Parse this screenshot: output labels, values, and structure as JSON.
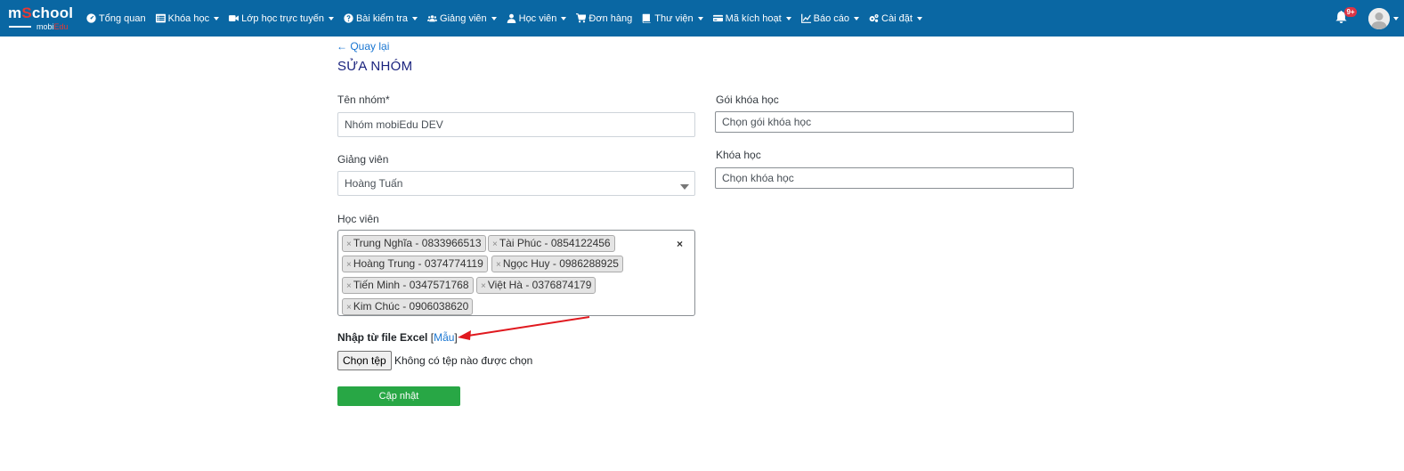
{
  "brand": {
    "logo_main_a": "m",
    "logo_main_b": "S",
    "logo_main_c": "chool",
    "logo_sub_a": "mobi",
    "logo_sub_b": "Edu"
  },
  "nav": {
    "items": [
      {
        "label": "Tổng quan",
        "icon": "dashboard-icon",
        "dropdown": false
      },
      {
        "label": "Khóa học",
        "icon": "list-icon",
        "dropdown": true
      },
      {
        "label": "Lớp học trực tuyến",
        "icon": "video-icon",
        "dropdown": true
      },
      {
        "label": "Bài kiểm tra",
        "icon": "question-circle-icon",
        "dropdown": true
      },
      {
        "label": "Giảng viên",
        "icon": "users-icon",
        "dropdown": true
      },
      {
        "label": "Học viên",
        "icon": "user-icon",
        "dropdown": true
      },
      {
        "label": "Đơn hàng",
        "icon": "cart-icon",
        "dropdown": false
      },
      {
        "label": "Thư viện",
        "icon": "book-icon",
        "dropdown": true
      },
      {
        "label": "Mã kích hoạt",
        "icon": "credit-card-icon",
        "dropdown": true
      },
      {
        "label": "Báo cáo",
        "icon": "chart-line-icon",
        "dropdown": true
      },
      {
        "label": "Cài đặt",
        "icon": "gears-icon",
        "dropdown": true
      }
    ],
    "notification_count": "9+"
  },
  "page": {
    "back_label": "← Quay lại",
    "title": "SỬA NHÓM"
  },
  "form": {
    "group_name_label": "Tên nhóm*",
    "group_name_value": "Nhóm mobiEdu DEV",
    "teacher_label": "Giảng viên",
    "teacher_value": "Hoàng Tuấn",
    "students_label": "Học viên",
    "students": [
      "Trung Nghĩa - 0833966513",
      "Tài Phúc - 0854122456",
      "Hoàng Trung - 0374774119",
      "Ngọc Huy - 0986288925",
      "Tiến Minh - 0347571768",
      "Việt Hà - 0376874179",
      "Kim Chúc - 0906038620"
    ],
    "tag_remove_glyph": "×",
    "clear_all_glyph": "×",
    "package_label": "Gói khóa học",
    "package_placeholder": "Chọn gói khóa học",
    "course_label": "Khóa học",
    "course_placeholder": "Chọn khóa học",
    "excel_label": "Nhập từ file Excel",
    "excel_bracket_open": "[",
    "excel_template_link": "Mẫu",
    "excel_bracket_close": "]",
    "file_button": "Chọn tệp",
    "file_status": "Không có tệp nào được chọn",
    "submit_label": "Cập nhật"
  },
  "colors": {
    "nav_bg": "#0a67a3",
    "link": "#1976d2",
    "title": "#1a237e",
    "submit": "#28a745",
    "annotation_arrow": "#e0191f",
    "badge": "#dc3545"
  }
}
